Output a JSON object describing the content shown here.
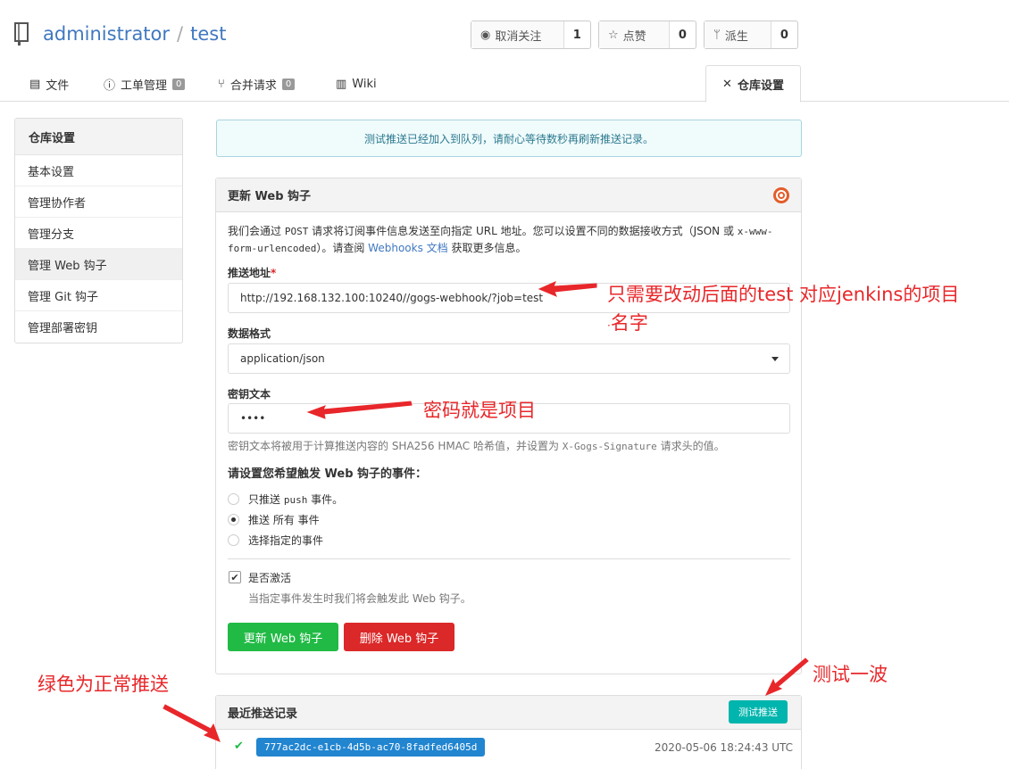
{
  "header": {
    "owner": "administrator",
    "separator": "/",
    "repo": "test",
    "watch": {
      "label": "取消关注",
      "count": "1"
    },
    "star": {
      "label": "点赞",
      "count": "0"
    },
    "fork": {
      "label": "派生",
      "count": "0"
    }
  },
  "tabs": [
    {
      "label": "文件"
    },
    {
      "label": "工单管理",
      "badge": "0"
    },
    {
      "label": "合并请求",
      "badge": "0"
    },
    {
      "label": "Wiki"
    },
    {
      "label": "仓库设置"
    }
  ],
  "sidebar": {
    "title": "仓库设置",
    "items": [
      {
        "label": "基本设置"
      },
      {
        "label": "管理协作者"
      },
      {
        "label": "管理分支"
      },
      {
        "label": "管理 Web 钩子"
      },
      {
        "label": "管理 Git 钩子"
      },
      {
        "label": "管理部署密钥"
      }
    ]
  },
  "alert": "测试推送已经加入到队列，请耐心等待数秒再刷新推送记录。",
  "form": {
    "title": "更新 Web 钩子",
    "desc_part1": "我们会通过 ",
    "desc_post": "POST",
    "desc_part2": " 请求将订阅事件信息发送至向指定 URL 地址。您可以设置不同的数据接收方式（JSON 或 ",
    "desc_mono2": "x-www-form-urlencoded",
    "desc_part3": "）。请查阅 ",
    "desc_link": "Webhooks 文档",
    "desc_part4": " 获取更多信息。",
    "url_label": "推送地址",
    "url_required": "*",
    "url_value": "http://192.168.132.100:10240//gogs-webhook/?job=test",
    "format_label": "数据格式",
    "format_value": "application/json",
    "secret_label": "密钥文本",
    "secret_value": "••••",
    "secret_help_1": "密钥文本将被用于计算推送内容的 SHA256 HMAC 哈希值，并设置为 ",
    "secret_help_mono": "X-Gogs-Signature",
    "secret_help_2": " 请求头的值。",
    "events_title": "请设置您希望触发 Web 钩子的事件：",
    "event_push_1": "只推送 ",
    "event_push_mono": "push",
    "event_push_2": " 事件。",
    "event_all": "推送 所有 事件",
    "event_choose": "选择指定的事件",
    "active_label": "是否激活",
    "active_help": "当指定事件发生时我们将会触发此 Web 钩子。",
    "update_button": "更新 Web 钩子",
    "delete_button": "删除 Web 钩子"
  },
  "deliveries": {
    "title": "最近推送记录",
    "test_button": "测试推送",
    "rows": [
      {
        "uuid": "777ac2dc-e1cb-4d5b-ac70-8fadfed6405d",
        "time": "2020-05-06 18:24:43 UTC"
      }
    ]
  },
  "annotations": {
    "url_note_1": "只需要改动后面的test 对应jenkins的项目",
    "url_note_2": "名字",
    "secret_note": "密码就是项目",
    "test_note": "测试一波",
    "green_note": "绿色为正常推送"
  },
  "colors": {
    "link": "#4078c0",
    "green": "#21ba45",
    "red": "#db2828",
    "teal": "#00b5ad",
    "blue": "#2185d0",
    "annotation": "#e8272a"
  }
}
